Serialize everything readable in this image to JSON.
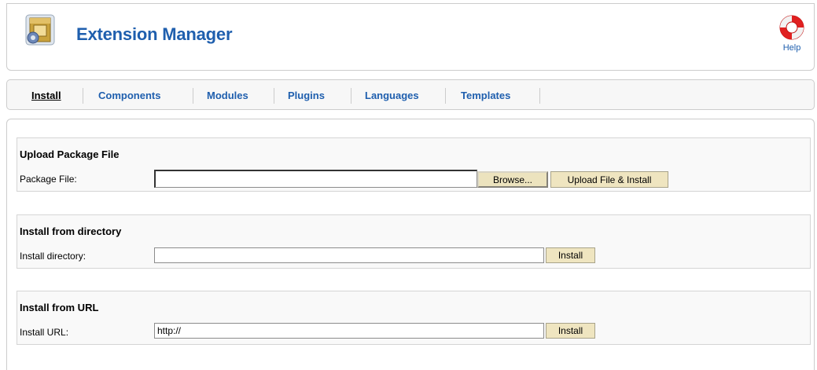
{
  "header": {
    "title": "Extension Manager",
    "help_label": "Help",
    "app_icon": "extension-package-icon",
    "help_icon": "lifebuoy-icon"
  },
  "tabs": [
    {
      "label": "Install",
      "active": true
    },
    {
      "label": "Components",
      "active": false
    },
    {
      "label": "Modules",
      "active": false
    },
    {
      "label": "Plugins",
      "active": false
    },
    {
      "label": "Languages",
      "active": false
    },
    {
      "label": "Templates",
      "active": false
    }
  ],
  "upload": {
    "title": "Upload Package File",
    "label": "Package File:",
    "value": "",
    "browse_label": "Browse...",
    "submit_label": "Upload File & Install"
  },
  "directory": {
    "title": "Install from directory",
    "label": "Install directory:",
    "value": "",
    "submit_label": "Install"
  },
  "url": {
    "title": "Install from URL",
    "label": "Install URL:",
    "value": "http://",
    "submit_label": "Install"
  },
  "colors": {
    "link": "#1f5fae",
    "button_bg": "#efe5c0",
    "help_icon_red": "#e02020"
  }
}
